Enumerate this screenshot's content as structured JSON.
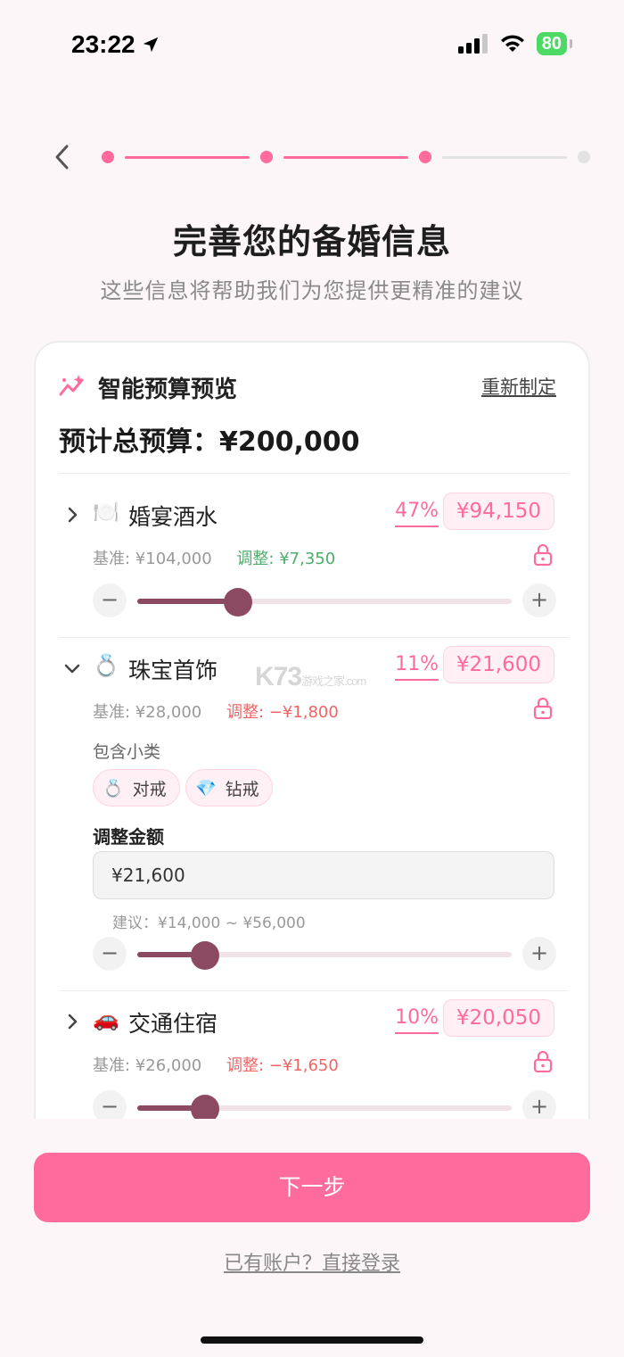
{
  "status_bar": {
    "time": "23:22",
    "battery": "80"
  },
  "progress": {
    "total_steps": 4,
    "current_step": 3
  },
  "header": {
    "title": "完善您的备婚信息",
    "subtitle": "这些信息将帮助我们为您提供更精准的建议"
  },
  "budget_card": {
    "title": "智能预算预览",
    "redo_label": "重新制定",
    "total_label": "预计总预算：¥200,000",
    "items": [
      {
        "emoji": "🍽️",
        "name": "婚宴酒水",
        "percent": "47%",
        "amount": "¥94,150",
        "base": "基准: ¥104,000",
        "adjust": "调整: ¥7,350",
        "adjust_sign": "positive",
        "expanded": false,
        "slider_level": 0.27
      },
      {
        "emoji": "💍",
        "name": "珠宝首饰",
        "percent": "11%",
        "amount": "¥21,600",
        "base": "基准: ¥28,000",
        "adjust": "调整: −¥1,800",
        "adjust_sign": "negative",
        "expanded": true,
        "subcategory_label": "包含小类",
        "subcategories": [
          {
            "emoji": "💍",
            "name": "对戒"
          },
          {
            "emoji": "💎",
            "name": "钻戒"
          }
        ],
        "adjust_amount_label": "调整金额",
        "adjust_amount_value": "¥21,600",
        "suggestion": "建议：¥14,000 ~ ¥56,000",
        "slider_level": 0.18
      },
      {
        "emoji": "🚗",
        "name": "交通住宿",
        "percent": "10%",
        "amount": "¥20,050",
        "base": "基准: ¥26,000",
        "adjust": "调整: −¥1,650",
        "adjust_sign": "negative",
        "expanded": false,
        "slider_level": 0.18
      }
    ]
  },
  "watermark": {
    "main": "K73",
    "sub": "游戏之家",
    "domain": ".com"
  },
  "footer": {
    "next_label": "下一步",
    "login_link": "已有账户？直接登录"
  },
  "colors": {
    "accent": "#ff6b9d",
    "slider": "#8b4a62",
    "positive": "#4cae6a",
    "negative": "#f06464",
    "inactive": "#e0e0e0"
  }
}
